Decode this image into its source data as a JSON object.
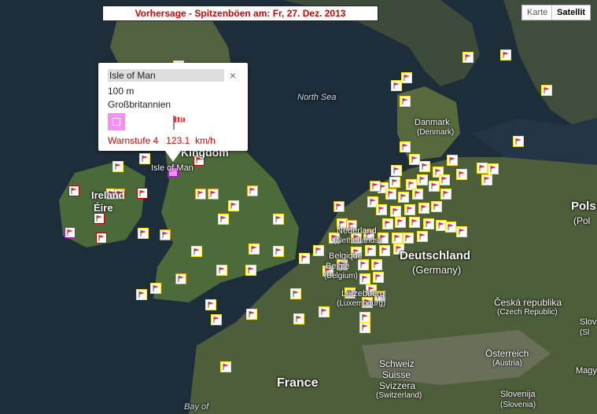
{
  "header": {
    "title": "Vorhersage - Spitzenböen am: Fr, 27. Dez. 2013"
  },
  "maptype": {
    "karte": "Karte",
    "satellit": "Satellit"
  },
  "labels": [
    {
      "id": "north-sea",
      "text": "North Sea"
    },
    {
      "id": "danmark",
      "text": "Danmark"
    },
    {
      "id": "denmark",
      "text": "(Denmark)"
    },
    {
      "id": "kingdom",
      "text": "Kingdom"
    },
    {
      "id": "isle",
      "text": "Isle of Man"
    },
    {
      "id": "ireland",
      "text": "Ireland"
    },
    {
      "id": "eire",
      "text": "Éire"
    },
    {
      "id": "nederland",
      "text": "Nederland"
    },
    {
      "id": "netherlands",
      "text": "(Netherlands)"
    },
    {
      "id": "belgique",
      "text": "Belgique"
    },
    {
      "id": "belgie",
      "text": "België"
    },
    {
      "id": "belgium",
      "text": "(Belgium)"
    },
    {
      "id": "deutschland",
      "text": "Deutschland"
    },
    {
      "id": "germany",
      "text": "(Germany)"
    },
    {
      "id": "letzebuerg",
      "text": "Lëtzebuerg"
    },
    {
      "id": "luxembourg",
      "text": "(Luxembourg)"
    },
    {
      "id": "france",
      "text": "France"
    },
    {
      "id": "schweiz",
      "text": "Schweiz"
    },
    {
      "id": "suisse",
      "text": "Suisse"
    },
    {
      "id": "svizzera",
      "text": "Svizzera"
    },
    {
      "id": "switzerland",
      "text": "(Switzerland)"
    },
    {
      "id": "cesko",
      "text": "Česká republika"
    },
    {
      "id": "czech",
      "text": "(Czech Republic)"
    },
    {
      "id": "osterreich",
      "text": "Österreich"
    },
    {
      "id": "austria",
      "text": "(Austria)"
    },
    {
      "id": "slovenija",
      "text": "Slovenija"
    },
    {
      "id": "slovenia",
      "text": "(Slovenia)"
    },
    {
      "id": "polska",
      "text": "Pols"
    },
    {
      "id": "pol",
      "text": "(Pol"
    },
    {
      "id": "bay",
      "text": "Bay of"
    },
    {
      "id": "slov",
      "text": "Slov"
    },
    {
      "id": "sl",
      "text": "(Sl"
    },
    {
      "id": "magy",
      "text": "Magy"
    }
  ],
  "popup": {
    "title": "Isle of Man",
    "close": "×",
    "altitude": "100 m",
    "country": "Großbritannien",
    "warning": "Warnstufe 4   123.1  km/h"
  },
  "colors": {
    "yellow": "#ffea00",
    "orange": "#f0a000",
    "red": "#c00000",
    "purple": "#a020c0",
    "pink": "#f58ef5"
  },
  "station_legend": {
    "yellow": "level-1",
    "orange": "level-2",
    "red": "level-3",
    "purple": "level-4"
  }
}
